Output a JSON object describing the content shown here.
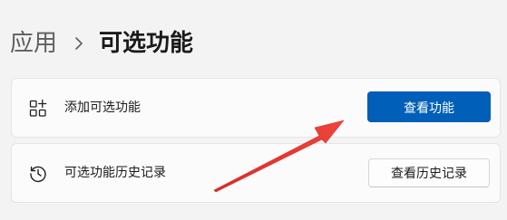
{
  "breadcrumb": {
    "parent": "应用",
    "separator_icon": "chevron-right-icon",
    "current": "可选功能"
  },
  "cards": {
    "add_feature": {
      "icon": "add-apps-icon",
      "label": "添加可选功能",
      "button_label": "查看功能"
    },
    "history": {
      "icon": "history-icon",
      "label": "可选功能历史记录",
      "button_label": "查看历史记录"
    }
  },
  "colors": {
    "background": "#f3f3f3",
    "card": "#fbfbfb",
    "accent": "#005fb8",
    "annotation_arrow": "#e8332f"
  }
}
